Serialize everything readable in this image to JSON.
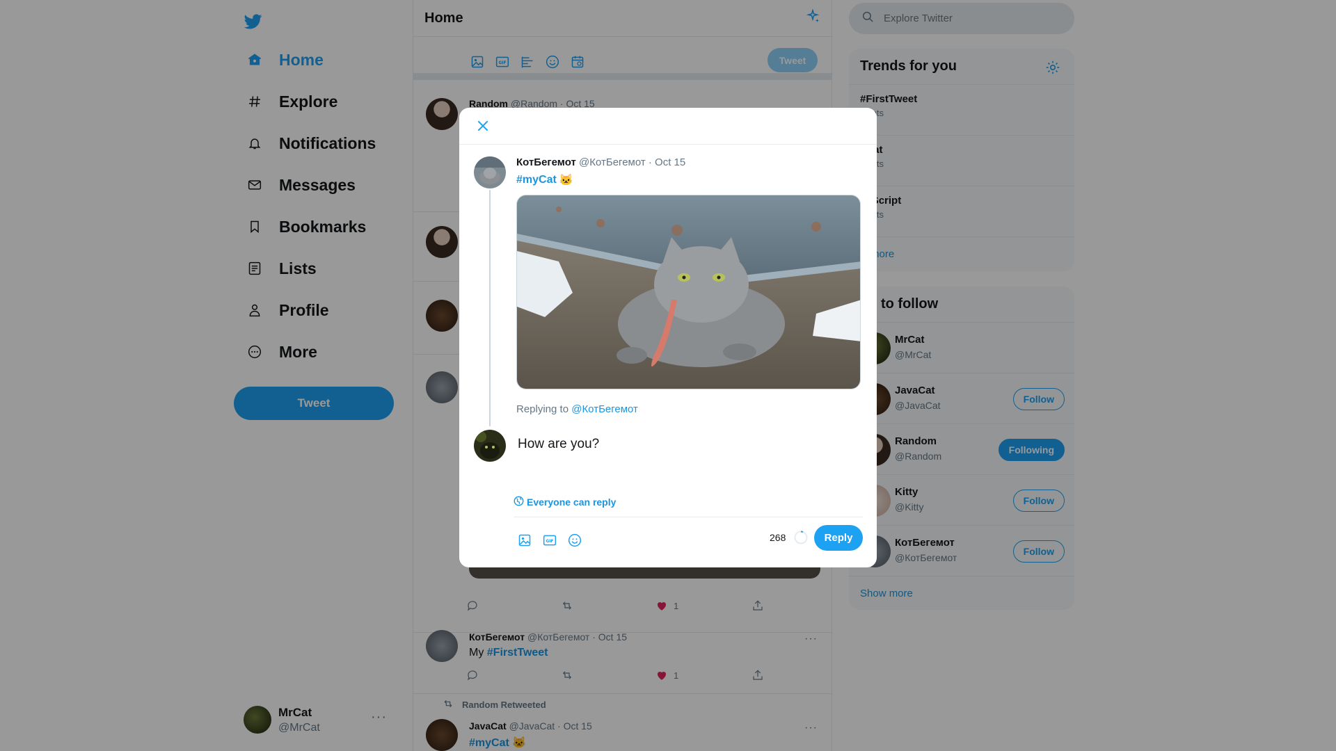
{
  "colors": {
    "accent": "#1da1f2",
    "link": "#1b95e0",
    "like": "#e0245e",
    "muted": "#657786"
  },
  "nav": {
    "items": [
      {
        "label": "Home",
        "icon": "home-icon"
      },
      {
        "label": "Explore",
        "icon": "hashtag-icon"
      },
      {
        "label": "Notifications",
        "icon": "bell-icon"
      },
      {
        "label": "Messages",
        "icon": "envelope-icon"
      },
      {
        "label": "Bookmarks",
        "icon": "bookmark-icon"
      },
      {
        "label": "Lists",
        "icon": "list-icon"
      },
      {
        "label": "Profile",
        "icon": "person-icon"
      },
      {
        "label": "More",
        "icon": "more-circle-icon"
      }
    ],
    "tweet_button": "Tweet"
  },
  "account": {
    "name": "MrCat",
    "handle": "@MrCat",
    "more": "···"
  },
  "timeline": {
    "title": "Home",
    "composer_tweet_button": "Tweet",
    "tweets": [
      {
        "name": "Random",
        "meta": "@Random · Oct 15"
      },
      {
        "name": "КотБегемот",
        "meta": "@КотБегемот · Oct 15",
        "text_prefix": "My ",
        "hashtag": "#FirstTweet",
        "likes": "1"
      },
      {
        "retweeted_by": "Random Retweeted",
        "name": "JavaCat",
        "meta": "@JavaCat · Oct 15",
        "hashtag": "#myCat"
      }
    ],
    "above_tweet_likes": "1"
  },
  "search": {
    "placeholder": "Explore Twitter"
  },
  "trends": {
    "title": "Trends for you",
    "items": [
      {
        "tag": "#FirstTweet",
        "count": "weets"
      },
      {
        "tag": "yCat",
        "count": "weets"
      },
      {
        "tag": "vaScript",
        "count": "weets"
      }
    ],
    "show_more": "w more"
  },
  "who_to_follow": {
    "title": "ho to follow",
    "users": [
      {
        "name": "MrCat",
        "handle": "@MrCat",
        "button": ""
      },
      {
        "name": "JavaCat",
        "handle": "@JavaCat",
        "button": "Follow"
      },
      {
        "name": "Random",
        "handle": "@Random",
        "button": "Following"
      },
      {
        "name": "Kitty",
        "handle": "@Kitty",
        "button": "Follow"
      },
      {
        "name": "КотБегемот",
        "handle": "@КотБегемот",
        "button": "Follow"
      }
    ],
    "show_more": "Show more"
  },
  "modal": {
    "original": {
      "name": "КотБегемот",
      "meta": "@КотБегемот · Oct 15",
      "hashtag": "#myCat",
      "emoji": "🐱"
    },
    "replying_prefix": "Replying to ",
    "replying_to": "@КотБегемот",
    "reply_value": "How are you?",
    "reply_scope": "Everyone can reply",
    "char_count": "268",
    "reply_button": "Reply"
  }
}
